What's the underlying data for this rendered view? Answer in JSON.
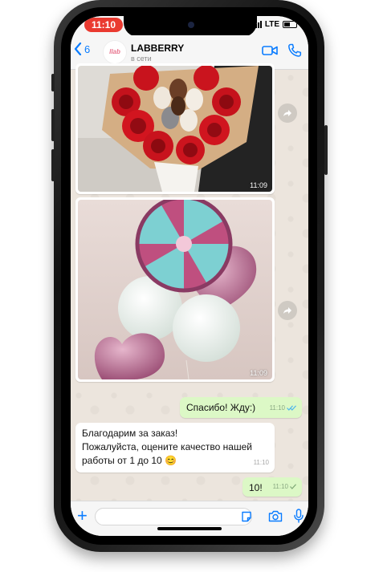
{
  "status_bar": {
    "time": "11:10",
    "network": "LTE"
  },
  "header": {
    "back_count": "6",
    "avatar_text": "llab berry",
    "contact_name": "LABBERRY",
    "contact_status": "в сети"
  },
  "messages": {
    "image1_time": "11:09",
    "image2_time": "11:09",
    "out1": {
      "text": "Спасибо! Жду:)",
      "time": "11:10"
    },
    "in1": {
      "line1": "Благодарим за заказ!",
      "line2": "Пожалуйста, оцените качество нашей",
      "line3": "работы от 1 до 10 😊",
      "time": "11:10"
    },
    "out2": {
      "text": "10!",
      "time": "11:10"
    }
  },
  "colors": {
    "accent": "#0a7cff",
    "outgoing_bubble": "#dcf8c6",
    "incoming_bubble": "#ffffff",
    "time_pill": "#ea3a30",
    "read_ticks": "#4fb6ec"
  },
  "icons": [
    "back-chevron-icon",
    "video-call-icon",
    "phone-call-icon",
    "forward-icon",
    "plus-icon",
    "sticker-icon",
    "camera-icon",
    "microphone-icon"
  ]
}
